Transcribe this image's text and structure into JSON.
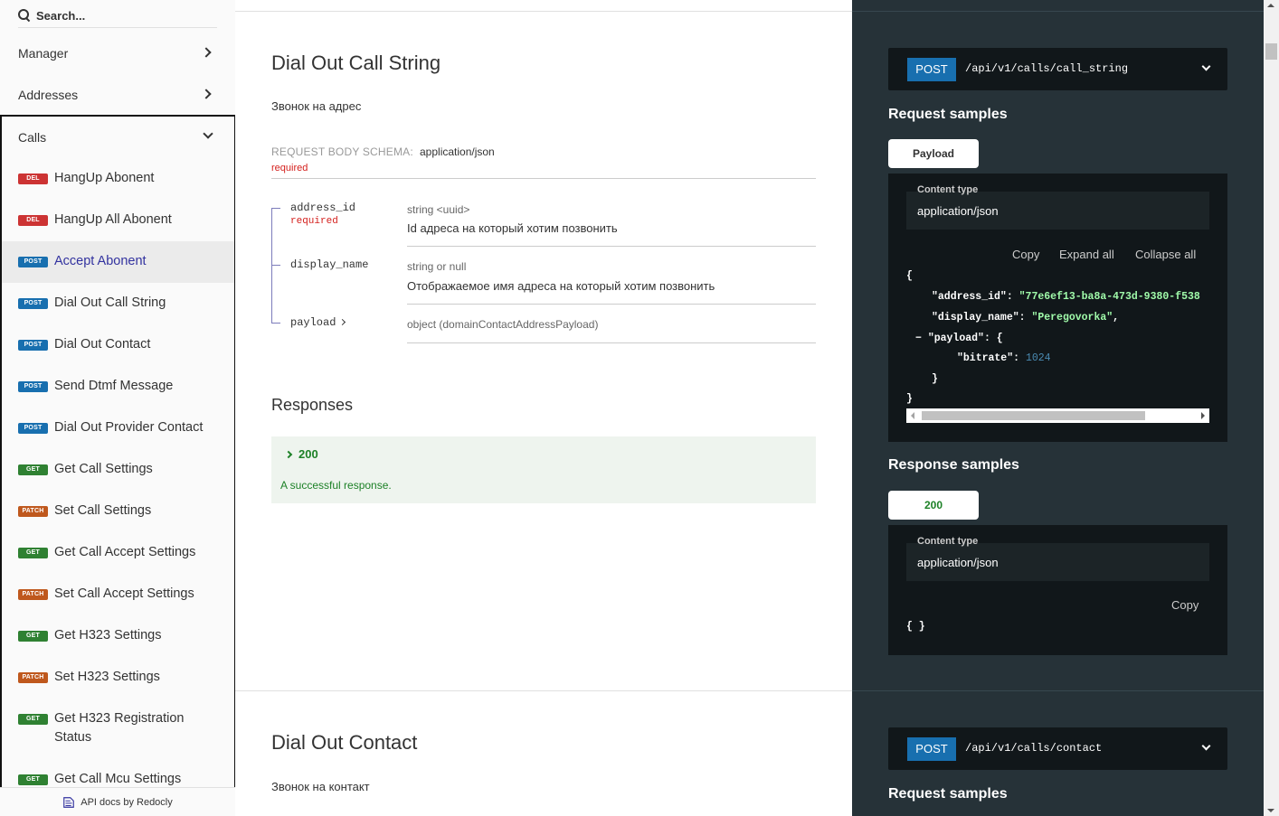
{
  "sidebar": {
    "search_placeholder": "Search...",
    "groups": [
      {
        "label": "Manager"
      },
      {
        "label": "Addresses"
      },
      {
        "label": "Calls"
      }
    ],
    "items": [
      {
        "method": "DEL",
        "label": "HangUp Abonent"
      },
      {
        "method": "DEL",
        "label": "HangUp All Abonent"
      },
      {
        "method": "POST",
        "label": "Accept Abonent"
      },
      {
        "method": "POST",
        "label": "Dial Out Call String"
      },
      {
        "method": "POST",
        "label": "Dial Out Contact"
      },
      {
        "method": "POST",
        "label": "Send Dtmf Message"
      },
      {
        "method": "POST",
        "label": "Dial Out Provider Contact"
      },
      {
        "method": "GET",
        "label": "Get Call Settings"
      },
      {
        "method": "PATCH",
        "label": "Set Call Settings"
      },
      {
        "method": "GET",
        "label": "Get Call Accept Settings"
      },
      {
        "method": "PATCH",
        "label": "Set Call Accept Settings"
      },
      {
        "method": "GET",
        "label": "Get H323 Settings"
      },
      {
        "method": "PATCH",
        "label": "Set H323 Settings"
      },
      {
        "method": "GET",
        "label": "Get H323 Registration Status"
      },
      {
        "method": "GET",
        "label": "Get Call Mcu Settings"
      }
    ],
    "footer": "API docs by Redocly"
  },
  "main": {
    "section1": {
      "title": "Dial Out Call String",
      "description": "Звонок на адрес",
      "schema_label": "REQUEST BODY SCHEMA:",
      "schema_type": "application/json",
      "schema_required": "required",
      "fields": [
        {
          "name": "address_id",
          "required": "required",
          "type": "string <uuid>",
          "description": "Id адреса на который хотим позвонить"
        },
        {
          "name": "display_name",
          "type": "string or null",
          "description": "Отображаемое имя адреса на который хотим позвонить"
        },
        {
          "name": "payload",
          "type": "object (domainContactAddressPayload)"
        }
      ],
      "responses_title": "Responses",
      "response_code": "200",
      "response_desc": "A successful response."
    },
    "section2": {
      "title": "Dial Out Contact",
      "description": "Звонок на контакт"
    }
  },
  "right": {
    "endpoint1": {
      "method": "POST",
      "path": "/api/v1/calls/call_string"
    },
    "request_samples": "Request samples",
    "payload_tab": "Payload",
    "content_type_label": "Content type",
    "content_type_value": "application/json",
    "copy": "Copy",
    "expand_all": "Expand all",
    "collapse_all": "Collapse all",
    "code": {
      "open": "{",
      "k1": "\"address_id\"",
      "v1": "\"77e6ef13-ba8a-473d-9380-f538",
      "k2": "\"display_name\"",
      "v2": "\"Peregovorka\"",
      "toggle": "−",
      "k3": "\"payload\"",
      "k4": "\"bitrate\"",
      "v4": "1024",
      "inner_close": "}",
      "close": "}"
    },
    "response_samples": "Response samples",
    "response_tab": "200",
    "response_copy": "Copy",
    "response_body": "{ }",
    "endpoint2": {
      "method": "POST",
      "path": "/api/v1/calls/contact"
    },
    "request_samples2": "Request samples"
  },
  "colors": {
    "del": "#cc3333",
    "post": "#186faf",
    "get": "#2f8132",
    "patch": "#bf581d",
    "accent": "#32329f"
  }
}
